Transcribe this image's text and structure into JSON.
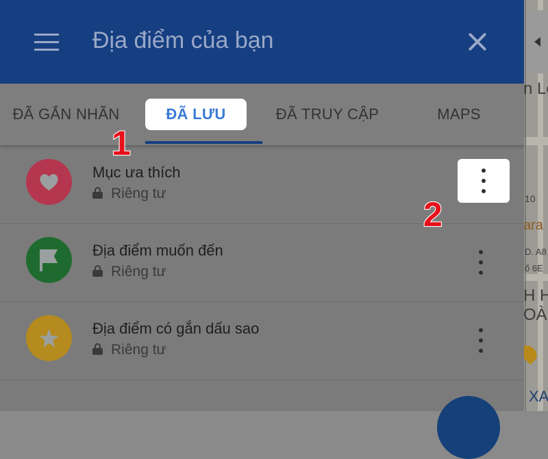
{
  "header": {
    "title": "Địa điểm của bạn"
  },
  "tabs": [
    {
      "label": "ĐÃ GẮN NHÃN",
      "active": false
    },
    {
      "label": "ĐÃ LƯU",
      "active": true
    },
    {
      "label": "ĐÃ TRUY CẬP",
      "active": false
    },
    {
      "label": "MAPS",
      "active": false
    }
  ],
  "lists": [
    {
      "title": "Mục ưa thích",
      "privacy": "Riêng tư",
      "icon": "heart-icon",
      "color": "#b5364f"
    },
    {
      "title": "Địa điểm muốn đến",
      "privacy": "Riêng tư",
      "icon": "flag-icon",
      "color": "#1f6b2f"
    },
    {
      "title": "Địa điểm có gắn dấu sao",
      "privacy": "Riêng tư",
      "icon": "star-icon",
      "color": "#b58a1e"
    }
  ],
  "annotations": {
    "step1": "1",
    "step2": "2"
  },
  "map_labels": [
    "n Lộ",
    "10",
    "ara",
    "D. A8",
    "ố 6E",
    "H H",
    "OÀ",
    "XA"
  ]
}
